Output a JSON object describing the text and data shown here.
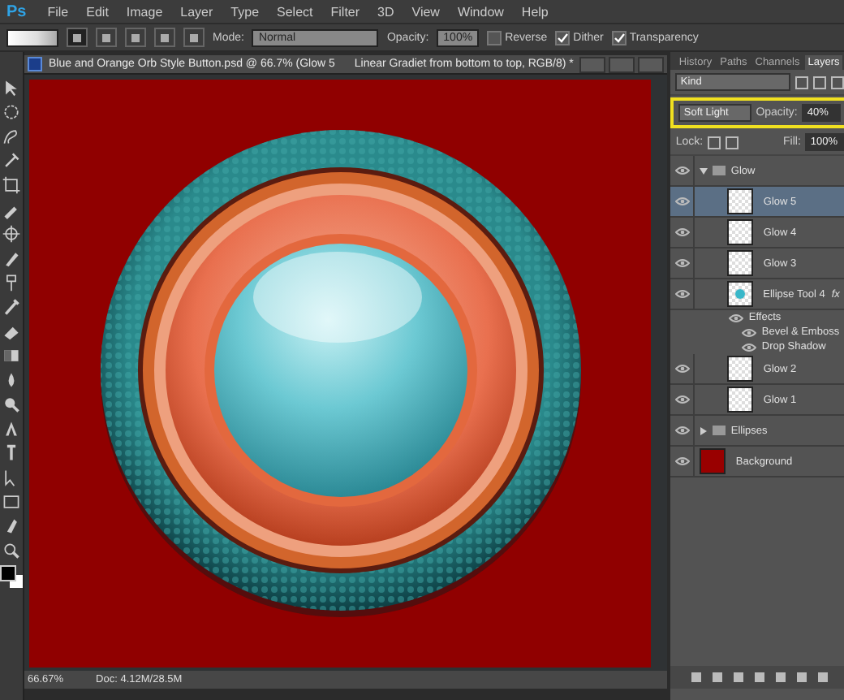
{
  "logo": "Ps",
  "menu": [
    "File",
    "Edit",
    "Image",
    "Layer",
    "Type",
    "Select",
    "Filter",
    "3D",
    "View",
    "Window",
    "Help"
  ],
  "options": {
    "gradient_types": [
      {
        "selected": true
      },
      {
        "selected": false
      },
      {
        "selected": false
      },
      {
        "selected": false
      },
      {
        "selected": false
      }
    ],
    "mode_label": "Mode:",
    "mode": "Normal",
    "opacity_label": "Opacity:",
    "opacity": "100%",
    "checks": [
      {
        "label": "Reverse",
        "checked": false
      },
      {
        "label": "Dither",
        "checked": true
      },
      {
        "label": "Transparency",
        "checked": true
      }
    ]
  },
  "document": {
    "title": "Blue and Orange Orb Style Button.psd @ 66.7% (Glow 5",
    "subtitle": "Linear Gradiet from bottom to top, RGB/8) *"
  },
  "status_bar": {
    "zoom": "66.67%",
    "doc": "Doc: 4.12M/28.5M"
  },
  "panel": {
    "tabs": [
      {
        "label": "History",
        "selected": false
      },
      {
        "label": "Paths",
        "selected": false
      },
      {
        "label": "Channels",
        "selected": false
      },
      {
        "label": "Layers",
        "selected": true
      }
    ],
    "filter": "Kind",
    "blend_mode": "Soft Light",
    "opacity_label": "Opacity:",
    "opacity": "40%",
    "lock_label": "Lock:",
    "fill_label": "Fill:",
    "fill": "100%",
    "layers": [
      {
        "name": "Glow",
        "kind": "group",
        "visible": true,
        "selected": false,
        "expanded": true,
        "children": [
          {
            "name": "Glow 5",
            "kind": "layer",
            "visible": true,
            "selected": true
          },
          {
            "name": "Glow 4",
            "kind": "layer",
            "visible": true,
            "selected": false
          },
          {
            "name": "Glow 3",
            "kind": "layer",
            "visible": true,
            "selected": false
          },
          {
            "name": "Ellipse Tool 4",
            "kind": "shape",
            "visible": true,
            "selected": false,
            "fx": "fx",
            "effects": {
              "label": "Effects",
              "items": [
                "Bevel & Emboss",
                "Drop Shadow"
              ]
            }
          },
          {
            "name": "Glow 2",
            "kind": "layer",
            "visible": true,
            "selected": false
          },
          {
            "name": "Glow 1",
            "kind": "layer",
            "visible": true,
            "selected": false
          }
        ]
      },
      {
        "name": "Ellipses",
        "kind": "group",
        "visible": true,
        "selected": false,
        "expanded": false
      },
      {
        "name": "Background",
        "kind": "fill",
        "visible": true,
        "selected": false,
        "color": "#990000"
      }
    ]
  }
}
